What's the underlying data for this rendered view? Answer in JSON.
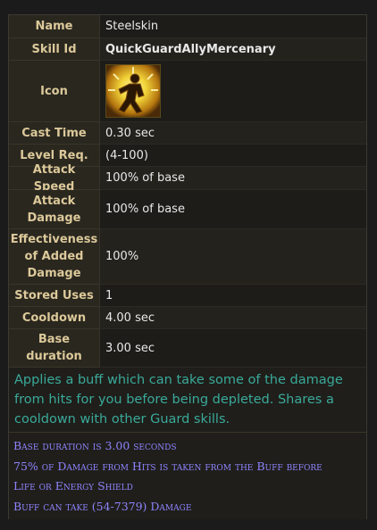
{
  "rows": [
    {
      "label": "Name",
      "value": "Steelskin"
    },
    {
      "label": "Skill Id",
      "value": "QuickGuardAllyMercenary"
    },
    {
      "label": "Icon",
      "value": ""
    },
    {
      "label": "Cast Time",
      "value": "0.30 sec"
    },
    {
      "label": "Level Req.",
      "value": "(4-100)"
    },
    {
      "label": "Attack Speed",
      "value": "100% of base"
    },
    {
      "label": "Attack Damage",
      "value": "100% of base"
    },
    {
      "label": "Effectiveness of Added Damage",
      "value": "100%"
    },
    {
      "label": "Stored Uses",
      "value": "1"
    },
    {
      "label": "Cooldown",
      "value": "4.00 sec"
    },
    {
      "label": "Base duration",
      "value": "3.00 sec"
    }
  ],
  "icon": {
    "name": "steelskin-skill-icon",
    "colors": [
      "#f2d43a",
      "#b5760f",
      "#4a2a08"
    ]
  },
  "description": "Applies a buff which can take some of the damage from hits for you before being depleted. Shares a cooldown with other Guard skills.",
  "stats": [
    "Base duration is 3.00 seconds",
    "75% of Damage from Hits is taken from the Buff before",
    "Life or Energy Shield",
    "Buff can take (54-7379) Damage"
  ],
  "colors": {
    "label": "#dcc99a",
    "value": "#e8e8e8",
    "description": "#3aa99a",
    "stat": "#8e84ff"
  }
}
